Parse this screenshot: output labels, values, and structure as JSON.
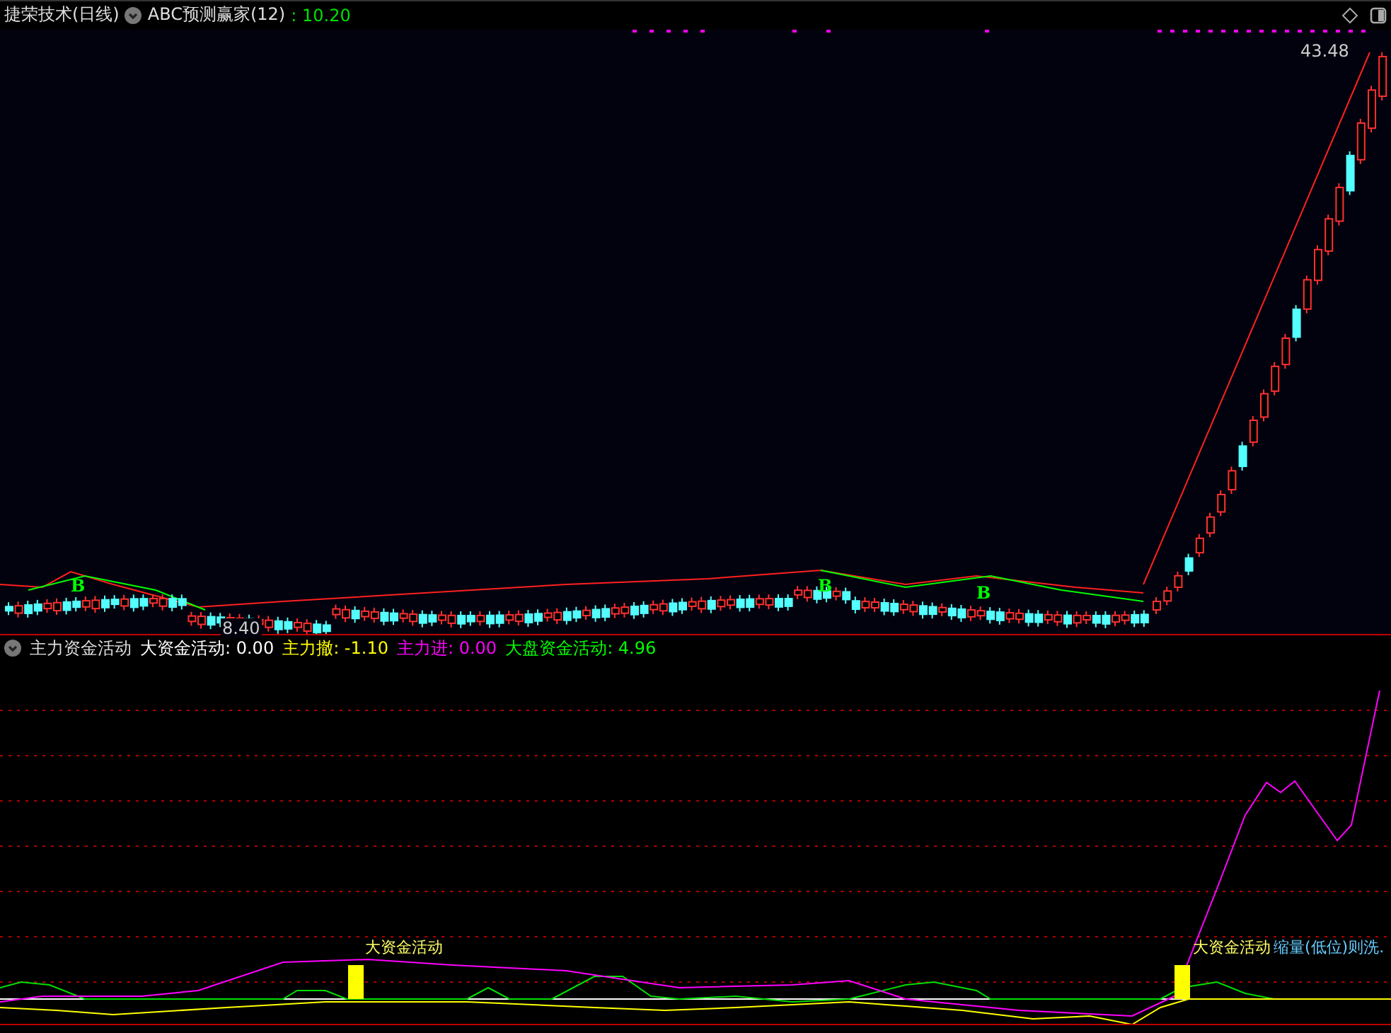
{
  "main_panel": {
    "title": "捷荣技术(日线)",
    "indicator": {
      "name": "ABC预测赢家(12)",
      "value": ": 10.20"
    },
    "price_labels": [
      "43.48",
      "8.40"
    ],
    "signal_marks": [
      {
        "text": "B"
      },
      {
        "text": "B"
      },
      {
        "text": "B"
      }
    ]
  },
  "sub_panel": {
    "title": "主力资金活动",
    "values": [
      {
        "label": "大资金活动: 0.00",
        "color": "#ffffff"
      },
      {
        "label": "主力撤: -1.10",
        "color": "#ffff00"
      },
      {
        "label": "主力进: 0.00",
        "color": "#ff00ff"
      },
      {
        "label": "大盘资金活动: 4.96",
        "color": "#00ff00"
      }
    ],
    "annotations": [
      "大资金活动",
      "大资金活动",
      "缩量(低位)则洗."
    ]
  }
}
